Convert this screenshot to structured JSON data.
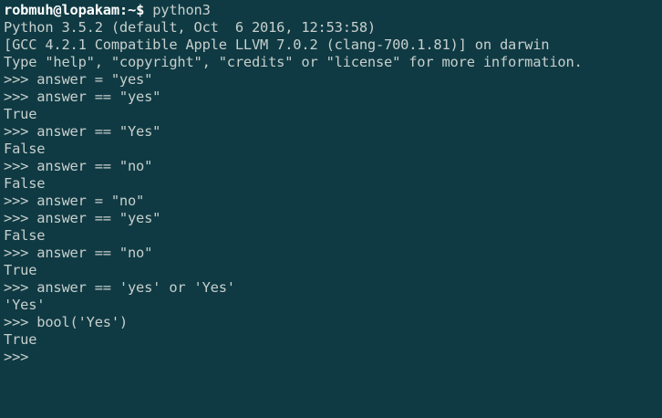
{
  "shell": {
    "user_host": "robmuh@lopakam:",
    "path_prompt": "~$",
    "command": " python3"
  },
  "lines": [
    "Python 3.5.2 (default, Oct  6 2016, 12:53:58)",
    "[GCC 4.2.1 Compatible Apple LLVM 7.0.2 (clang-700.1.81)] on darwin",
    "Type \"help\", \"copyright\", \"credits\" or \"license\" for more information.",
    ">>> answer = \"yes\"",
    ">>> answer == \"yes\"",
    "True",
    ">>> answer == \"Yes\"",
    "False",
    ">>> answer == \"no\"",
    "False",
    ">>> answer = \"no\"",
    ">>> answer == \"yes\"",
    "False",
    ">>> answer == \"no\"",
    "True",
    ">>> answer == 'yes' or 'Yes'",
    "'Yes'",
    ">>> bool('Yes')",
    "True",
    ">>> "
  ],
  "colors": {
    "background": "#0f3a43",
    "text": "#c7cfcd",
    "prompt": "#ffffff"
  }
}
